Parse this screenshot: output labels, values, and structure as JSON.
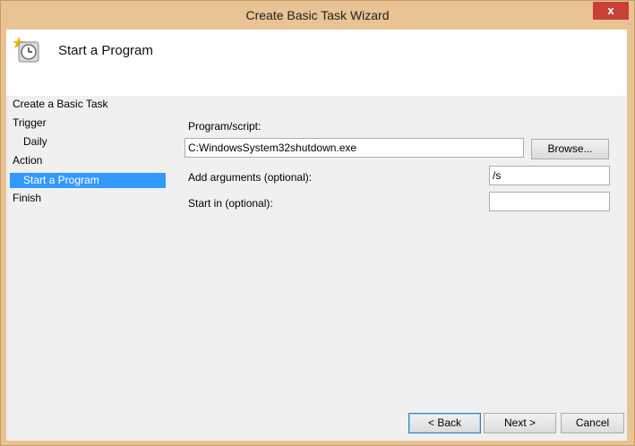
{
  "window": {
    "title": "Create Basic Task Wizard",
    "close_label": "x"
  },
  "header": {
    "title": "Start a Program",
    "icon": "task-clock-icon"
  },
  "nav": {
    "items": [
      {
        "label": "Create a Basic Task"
      },
      {
        "label": "Trigger"
      },
      {
        "label": "Daily"
      },
      {
        "label": "Action"
      },
      {
        "label": "Start a Program"
      },
      {
        "label": "Finish"
      }
    ]
  },
  "form": {
    "program_label": "Program/script:",
    "program_value": "C:WindowsSystem32shutdown.exe",
    "browse_label": "Browse...",
    "args_label": "Add arguments (optional):",
    "args_value": "/s",
    "startin_label": "Start in (optional):",
    "startin_value": ""
  },
  "buttons": {
    "back": "< Back",
    "next": "Next >",
    "cancel": "Cancel"
  }
}
